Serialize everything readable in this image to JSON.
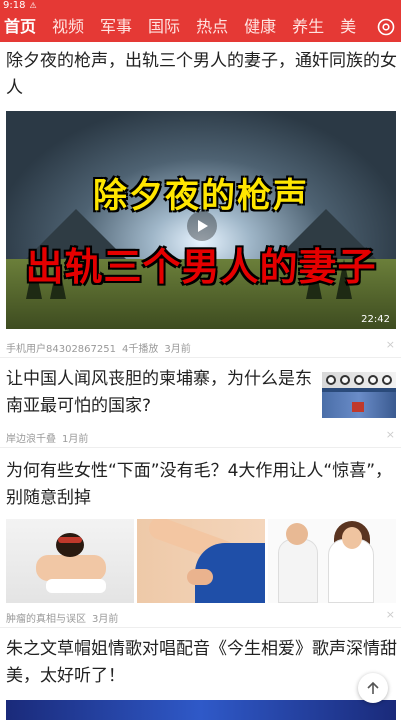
{
  "status_bar": {
    "time": "9:18",
    "warning_icon": "warning-icon"
  },
  "colors": {
    "brand_red": "#e53935",
    "title_text": "#222222",
    "meta_text": "#999999"
  },
  "top_nav": {
    "tabs": [
      {
        "label": "首页",
        "active": true
      },
      {
        "label": "视频",
        "active": false
      },
      {
        "label": "军事",
        "active": false
      },
      {
        "label": "国际",
        "active": false
      },
      {
        "label": "热点",
        "active": false
      },
      {
        "label": "健康",
        "active": false
      },
      {
        "label": "养生",
        "active": false
      },
      {
        "label": "美",
        "active": false
      }
    ],
    "more_icon": "channel-settings-icon"
  },
  "feed": {
    "articles": [
      {
        "title": "除夕夜的枪声，出轨三个男人的妻子，通奸同族的女人",
        "video": {
          "overlay_line1": "除夕夜的枪声",
          "overlay_line2": "出轨三个男人的妻子",
          "duration": "22:42"
        },
        "source": "手机用户84302867251",
        "plays": "4千播放",
        "time": "3月前"
      },
      {
        "title": "让中国人闻风丧胆的柬埔寨，为什么是东南亚最可怕的国家?",
        "source": "岸边浪千叠",
        "time": "1月前"
      },
      {
        "title": "为何有些女性“下面”没有毛？4大作用让人“惊喜”，别随意刮掉",
        "source": "肿瘤的真相与误区",
        "time": "3月前"
      },
      {
        "title": "朱之文草帽姐情歌对唱配音《今生相爱》歌声深情甜美，太好听了！"
      }
    ]
  },
  "close_glyph": "×",
  "back_to_top_icon": "arrow-up-icon"
}
